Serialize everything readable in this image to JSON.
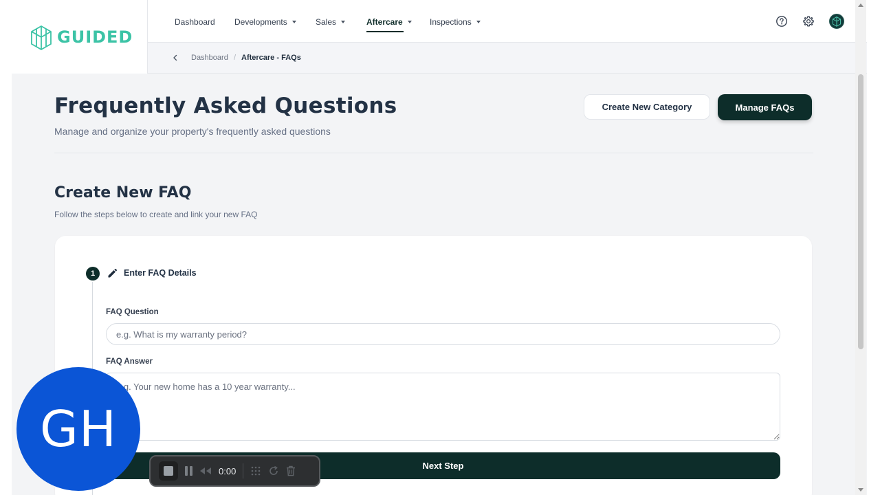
{
  "brand": {
    "name": "GUIDED",
    "accent": "#3cc3a6",
    "dark": "#0d2d2a"
  },
  "nav": {
    "items": [
      {
        "label": "Dashboard",
        "dropdown": false
      },
      {
        "label": "Developments",
        "dropdown": true
      },
      {
        "label": "Sales",
        "dropdown": true
      },
      {
        "label": "Aftercare",
        "dropdown": true,
        "active": true
      },
      {
        "label": "Inspections",
        "dropdown": true
      }
    ],
    "icons": [
      "help-circle-icon",
      "gear-icon",
      "user-avatar"
    ]
  },
  "breadcrumb": {
    "items": [
      "Dashboard",
      "Aftercare - FAQs"
    ],
    "separator": "/"
  },
  "header": {
    "title": "Frequently Asked Questions",
    "subtitle": "Manage and organize your property's frequently asked questions",
    "create_category_label": "Create New Category",
    "manage_faqs_label": "Manage FAQs"
  },
  "section": {
    "title": "Create New FAQ",
    "subtitle": "Follow the steps below to create and link your new FAQ"
  },
  "step1": {
    "number": "1",
    "label": "Enter FAQ Details",
    "question_label": "FAQ Question",
    "question_placeholder": "e.g. What is my warranty period?",
    "answer_label": "FAQ Answer",
    "answer_placeholder": "e.g. Your new home has a 10 year warranty...",
    "next_label": "Next Step"
  },
  "overlay": {
    "badge_initials": "GH",
    "recorder_time": "0:00"
  }
}
